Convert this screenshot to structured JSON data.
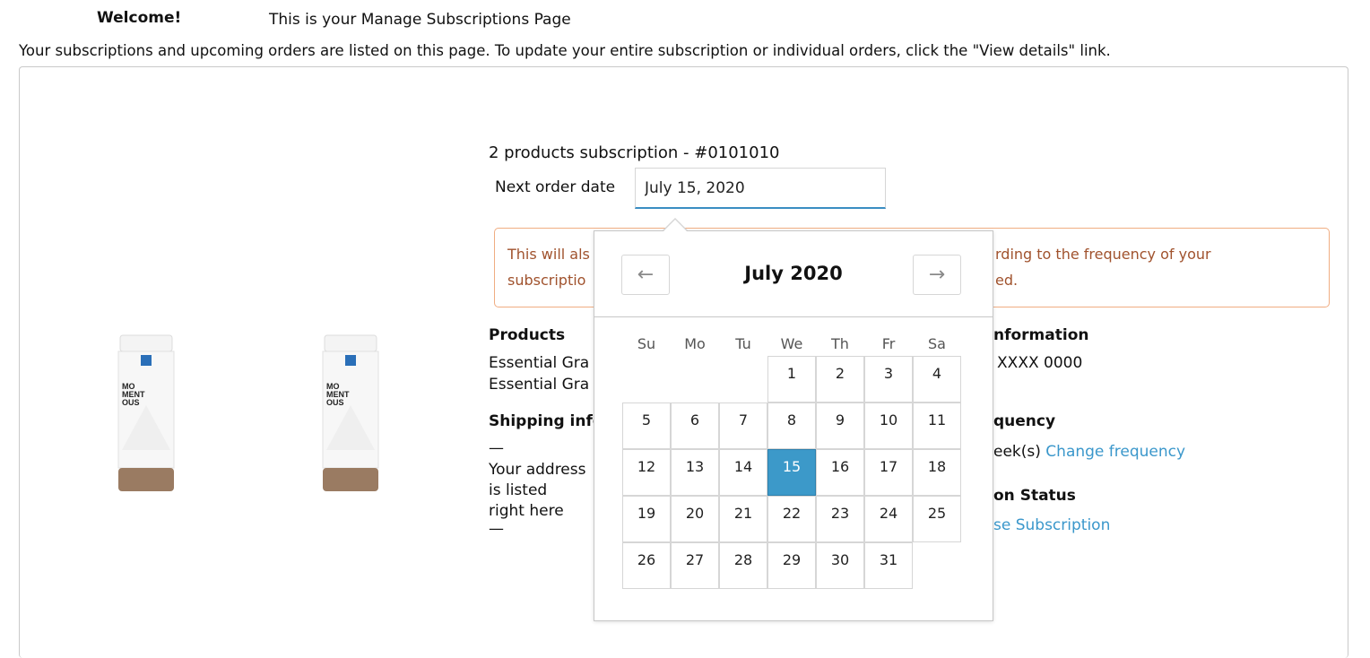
{
  "header": {
    "welcome": "Welcome!",
    "page_title": "This is your Manage Subscriptions Page",
    "intro": "Your subscriptions and upcoming orders are listed on this page. To update your entire subscription or individual orders, click the \"View details\" link."
  },
  "subscription": {
    "title": "2 products subscription -  #0101010",
    "next_order_label": "Next order date",
    "next_order_value": "July 15, 2020",
    "notice_left_1": "This will als",
    "notice_left_2": "subscriptio",
    "notice_right_1": "rding to the frequency of your",
    "notice_right_2": "ed.",
    "products_heading": "Products",
    "product_1": "Essential Gra",
    "product_2": "Essential Gra",
    "shipping_heading": "Shipping info",
    "shipping_dash_1": "—",
    "address_1": "Your address",
    "address_2": "is listed",
    "address_3": "right here",
    "shipping_dash_2": "—",
    "payment_heading": "nformation",
    "payment_value": "( XXXX 0000",
    "frequency_heading": "quency",
    "frequency_value": "eek(s)",
    "change_frequency": "Change frequency",
    "status_heading": "on Status",
    "pause_link": "se Subscription"
  },
  "product_images": [
    {
      "brand_l1": "MO",
      "brand_l2": "MENT",
      "brand_l3": "OUS"
    },
    {
      "brand_l1": "MO",
      "brand_l2": "MENT",
      "brand_l3": "OUS"
    }
  ],
  "datepicker": {
    "month": "July 2020",
    "prev_icon": "←",
    "next_icon": "→",
    "weekdays": [
      "Su",
      "Mo",
      "Tu",
      "We",
      "Th",
      "Fr",
      "Sa"
    ],
    "first_weekday_index": 3,
    "days": 31,
    "selected_day": 15
  },
  "colors": {
    "accent": "#3c99c9",
    "link": "#3a97cb",
    "notice_border": "#f0ad82",
    "notice_text": "#a0522d"
  }
}
